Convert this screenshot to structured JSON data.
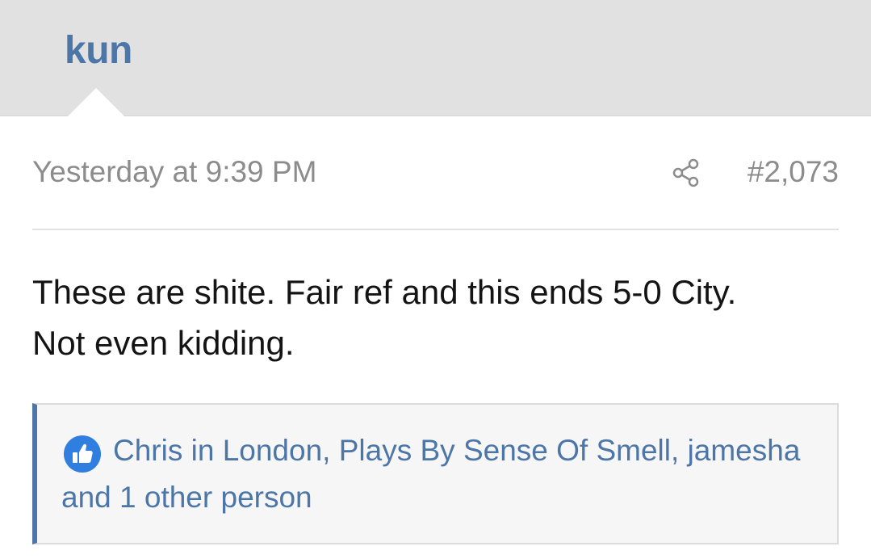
{
  "user": {
    "name": "kun"
  },
  "post": {
    "timestamp": "Yesterday at 9:39 PM",
    "number": "#2,073",
    "message_line1": "These are shite. Fair ref and this ends 5-0 City.",
    "message_line2": "Not even kidding."
  },
  "likes": {
    "icon": "thumbs-up-icon",
    "user1": "Chris in London",
    "sep1": ", ",
    "user2": "Plays By Sense Of Smell",
    "sep2": ", ",
    "user3": "jamesha",
    "and_text": " and ",
    "others": "1 other person"
  },
  "colors": {
    "username": "#4d76a8",
    "header_bg": "#e1e1e1",
    "meta_text": "#8c8c8c",
    "like_icon_bg": "#2f7ee0"
  }
}
